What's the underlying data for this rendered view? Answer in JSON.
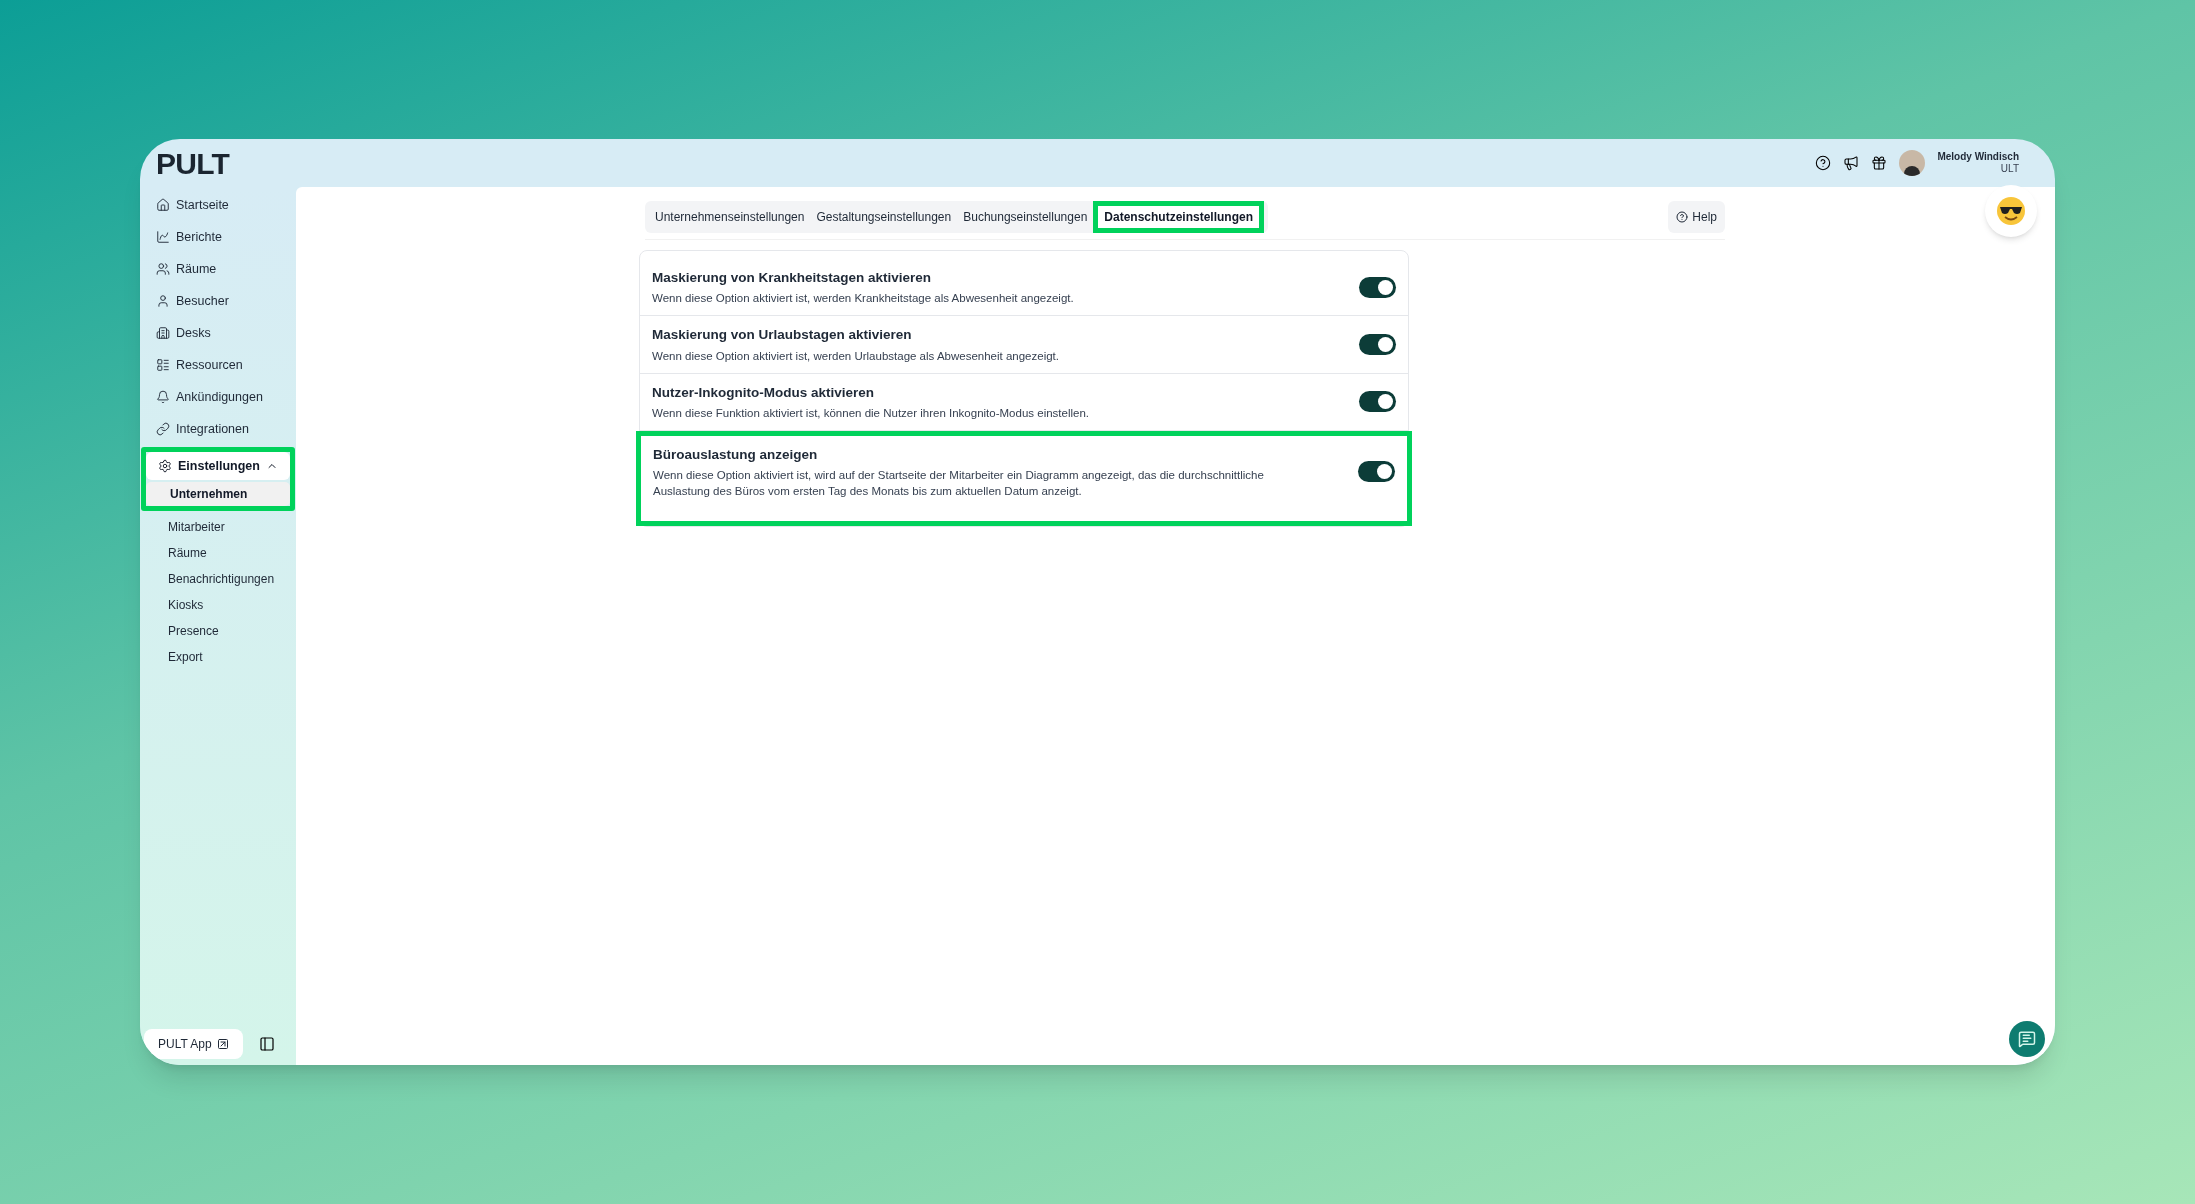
{
  "app": {
    "logo": "PULT"
  },
  "header": {
    "user": {
      "name": "Melody Windisch",
      "subtitle": "ULT"
    }
  },
  "sidebar": {
    "items": [
      {
        "label": "Startseite",
        "selected": false
      },
      {
        "label": "Berichte",
        "selected": false
      },
      {
        "label": "Räume",
        "selected": false
      },
      {
        "label": "Besucher",
        "selected": false
      },
      {
        "label": "Desks",
        "selected": false
      },
      {
        "label": "Ressourcen",
        "selected": false
      },
      {
        "label": "Ankündigungen",
        "selected": false
      },
      {
        "label": "Integrationen",
        "selected": false
      },
      {
        "label": "Einstellungen",
        "selected": true,
        "expanded": true,
        "highlighted": true,
        "children": [
          {
            "label": "Unternehmen",
            "selected": true
          },
          {
            "label": "Mitarbeiter",
            "selected": false
          },
          {
            "label": "Räume",
            "selected": false
          },
          {
            "label": "Benachrichtigungen",
            "selected": false
          },
          {
            "label": "Kiosks",
            "selected": false
          },
          {
            "label": "Presence",
            "selected": false
          },
          {
            "label": "Export",
            "selected": false
          }
        ]
      }
    ],
    "footer": {
      "app_link": "PULT App"
    }
  },
  "tabs": [
    {
      "label": "Unternehmenseinstellungen",
      "selected": false,
      "highlighted": false
    },
    {
      "label": "Gestaltungseinstellungen",
      "selected": false,
      "highlighted": false
    },
    {
      "label": "Buchungseinstellungen",
      "selected": false,
      "highlighted": false
    },
    {
      "label": "Datenschutzeinstellungen",
      "selected": true,
      "highlighted": true
    }
  ],
  "help_button": "Help",
  "settings": [
    {
      "title": "Maskierung von Krankheitstagen aktivieren",
      "description": "Wenn diese Option aktiviert ist, werden Krankheitstage als Abwesenheit angezeigt.",
      "on": true,
      "highlighted": false
    },
    {
      "title": "Maskierung von Urlaubstagen aktivieren",
      "description": "Wenn diese Option aktiviert ist, werden Urlaubstage als Abwesenheit angezeigt.",
      "on": true,
      "highlighted": false
    },
    {
      "title": "Nutzer-Inkognito-Modus aktivieren",
      "description": "Wenn diese Funktion aktiviert ist, können die Nutzer ihren Inkognito-Modus einstellen.",
      "on": true,
      "highlighted": false
    },
    {
      "title": "Büroauslastung anzeigen",
      "description": "Wenn diese Option aktiviert ist, wird auf der Startseite der Mitarbeiter ein Diagramm angezeigt, das die durchschnittliche Auslastung des Büros vom ersten Tag des Monats bis zum aktuellen Datum anzeigt.",
      "on": true,
      "highlighted": true
    }
  ]
}
